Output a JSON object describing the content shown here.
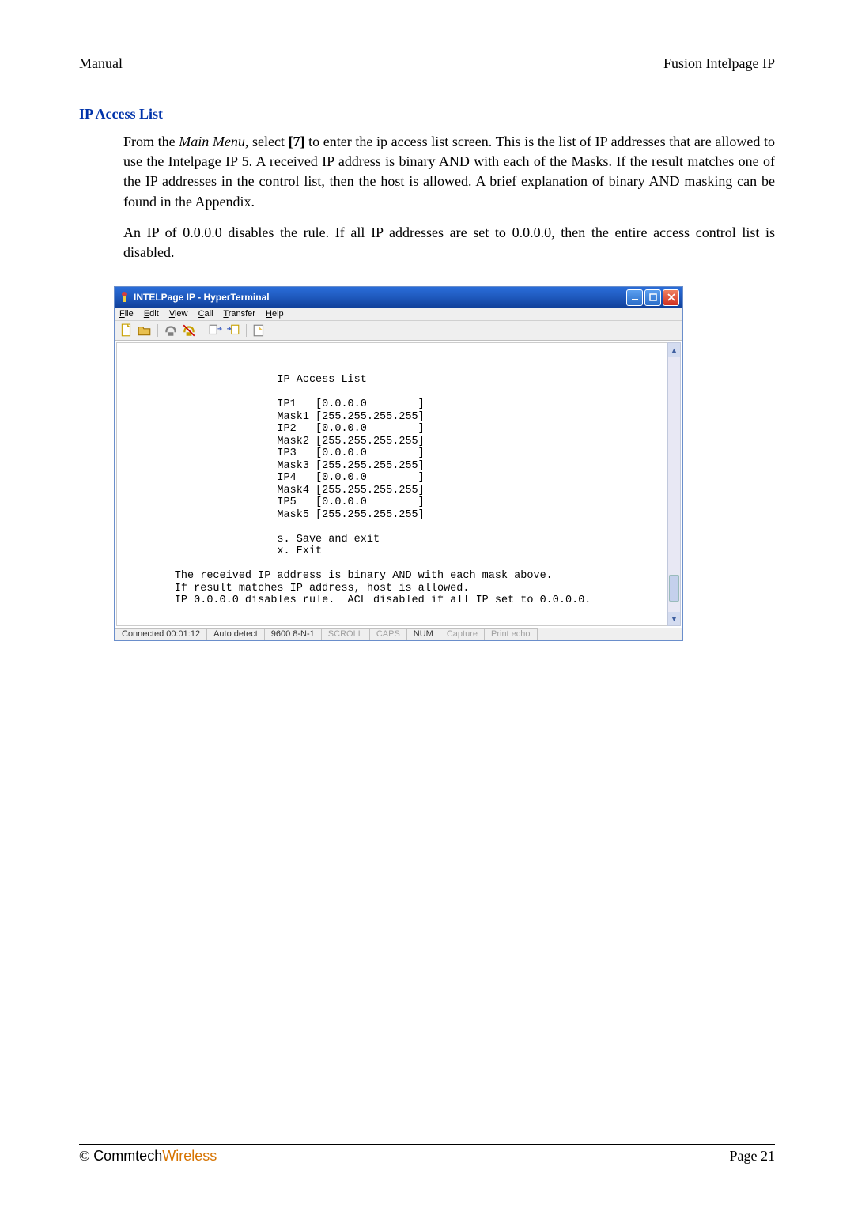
{
  "header": {
    "left": "Manual",
    "right": "Fusion Intelpage IP"
  },
  "section_title": "IP Access List",
  "para1_intro": "From the ",
  "para1_em": "Main Menu",
  "para1_mid": ", select ",
  "para1_bold": "[7]",
  "para1_rest": " to enter the ip access list screen. This is the list of IP addresses that are allowed to use the Intelpage IP 5. A received IP address is binary AND with each of the Masks. If the result matches one of the IP addresses in the control list, then the host is allowed. A brief explanation of binary AND masking can be found in the Appendix.",
  "para2": "An IP of 0.0.0.0 disables the rule. If all IP addresses are set to 0.0.0.0, then the entire access control list is disabled.",
  "terminal": {
    "title": "INTELPage IP - HyperTerminal",
    "menus": {
      "file": "File",
      "edit": "Edit",
      "view": "View",
      "call": "Call",
      "transfer": "Transfer",
      "help": "Help"
    },
    "content": "\n\n                        IP Access List\n\n                        IP1   [0.0.0.0        ]\n                        Mask1 [255.255.255.255]\n                        IP2   [0.0.0.0        ]\n                        Mask2 [255.255.255.255]\n                        IP3   [0.0.0.0        ]\n                        Mask3 [255.255.255.255]\n                        IP4   [0.0.0.0        ]\n                        Mask4 [255.255.255.255]\n                        IP5   [0.0.0.0        ]\n                        Mask5 [255.255.255.255]\n\n                        s. Save and exit\n                        x. Exit\n\n        The received IP address is binary AND with each mask above.\n        If result matches IP address, host is allowed.\n        IP 0.0.0.0 disables rule.  ACL disabled if all IP set to 0.0.0.0.\n\n",
    "statusbar": {
      "connected": "Connected 00:01:12",
      "detect": "Auto detect",
      "settings": "9600 8-N-1",
      "scroll": "SCROLL",
      "caps": "CAPS",
      "num": "NUM",
      "capture": "Capture",
      "printecho": "Print echo"
    }
  },
  "footer": {
    "copyright": "© ",
    "brand1": "Commtech",
    "brand2": "Wireless",
    "page": "Page 21"
  }
}
